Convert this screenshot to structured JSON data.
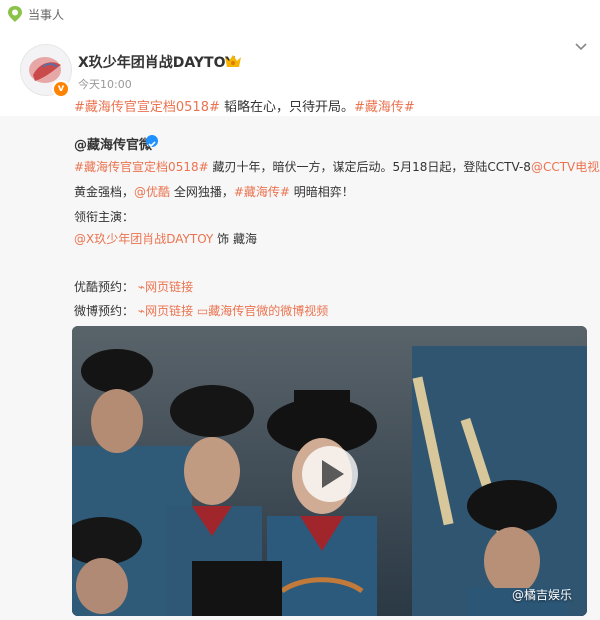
{
  "topbar": {
    "label": "当事人"
  },
  "post": {
    "author": "X玖少年团肖战DAYTOY",
    "time": "今天10:00",
    "tag1": "#藏海传官宣定档0518#",
    "body": " 韬略在心，只待开局。",
    "tag2": "#藏海传#"
  },
  "repost": {
    "author": "@藏海传官微",
    "line1": {
      "tag": "#藏海传官宣定档0518#",
      "text": " 藏刃十年，暗伏一方，谋定后动。5月18日起，登陆CCTV-8",
      "mention": "@CCTV电视剧"
    },
    "line2": {
      "prefix": "黄金强档，",
      "mention": "@优酷",
      "middle": " 全网独播，",
      "tag": "#藏海传#",
      "suffix": " 明暗相弈！"
    },
    "line3": "领衔主演：",
    "line4": {
      "mention": "@X玖少年团肖战DAYTOY",
      "suffix": " 饰 藏海"
    },
    "line5": {
      "label": "优酷预约：",
      "link": "网页链接"
    },
    "line6": {
      "label": "微博预约：",
      "link1": "网页链接",
      "link2": "藏海传官微的微博视频"
    }
  },
  "video": {
    "watermark": "@橘吉娱乐"
  },
  "colors": {
    "tag": "#eb7350",
    "verified_orange": "#ff8200",
    "verified_blue": "#1e90ff"
  },
  "icons": [
    "pin-icon",
    "crown-icon",
    "chevron-down-icon",
    "verified-icon",
    "link-icon",
    "video-icon",
    "play-icon"
  ]
}
